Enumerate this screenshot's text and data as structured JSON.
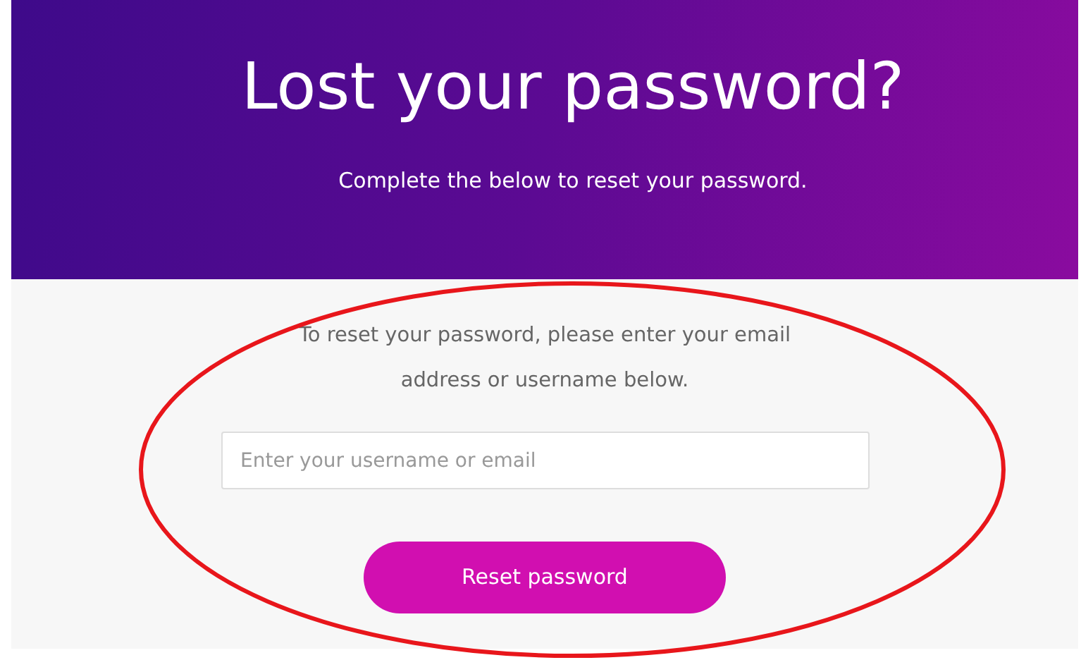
{
  "header": {
    "title": "Lost your password?",
    "subtitle": "Complete the below to reset your password."
  },
  "form": {
    "instructions": "To reset your password, please enter your email address or username below.",
    "field": {
      "placeholder": "Enter your username or email"
    },
    "button": "Reset password"
  },
  "annotation": {
    "kind": "ellipse",
    "color": "#e8161b"
  }
}
